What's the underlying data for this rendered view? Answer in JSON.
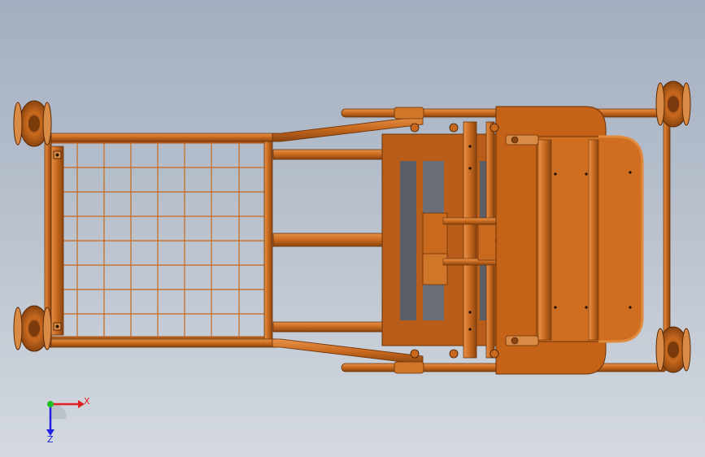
{
  "viewport": {
    "background_top": "#a3aec0",
    "background_bottom": "#d4d9e0"
  },
  "model": {
    "part_color": "#c8691e",
    "part_dark": "#8a4410",
    "part_light": "#e08a40",
    "slot_color": "#5a5e66"
  },
  "triad": {
    "x_label": "X",
    "z_label": "Z",
    "x_color": "#e02020",
    "y_color": "#20c020",
    "z_color": "#2020e0"
  }
}
